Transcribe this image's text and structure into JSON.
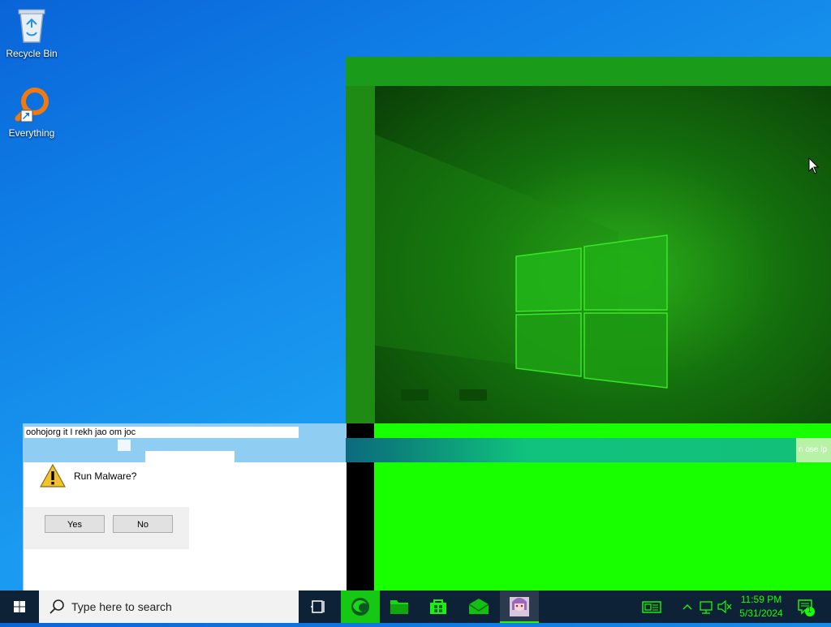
{
  "desktop": {
    "icons": [
      {
        "label": "Recycle Bin",
        "icon": "recycle-bin-icon"
      },
      {
        "label": "Everything",
        "icon": "everything-search-icon"
      }
    ]
  },
  "dialog": {
    "title": "oohojorg it  I rekh jao om joc",
    "message": "Run Malware?",
    "yes_label": "Yes",
    "no_label": "No",
    "icon": "warning-icon"
  },
  "glitch": {
    "strip_text": "n ose ip"
  },
  "taskbar": {
    "search_placeholder": "Type here to search",
    "clock_time": "11:59 PM",
    "clock_date": "5/31/2024",
    "notification_count": "1",
    "pinned": [
      "edge-icon",
      "file-explorer-icon",
      "store-icon",
      "mail-icon",
      "app-thumbnail-icon"
    ]
  },
  "colors": {
    "accent_green": "#18ff00",
    "taskbar_bg": "#0d2236",
    "dialog_title_bg": "#8fcdf2"
  }
}
